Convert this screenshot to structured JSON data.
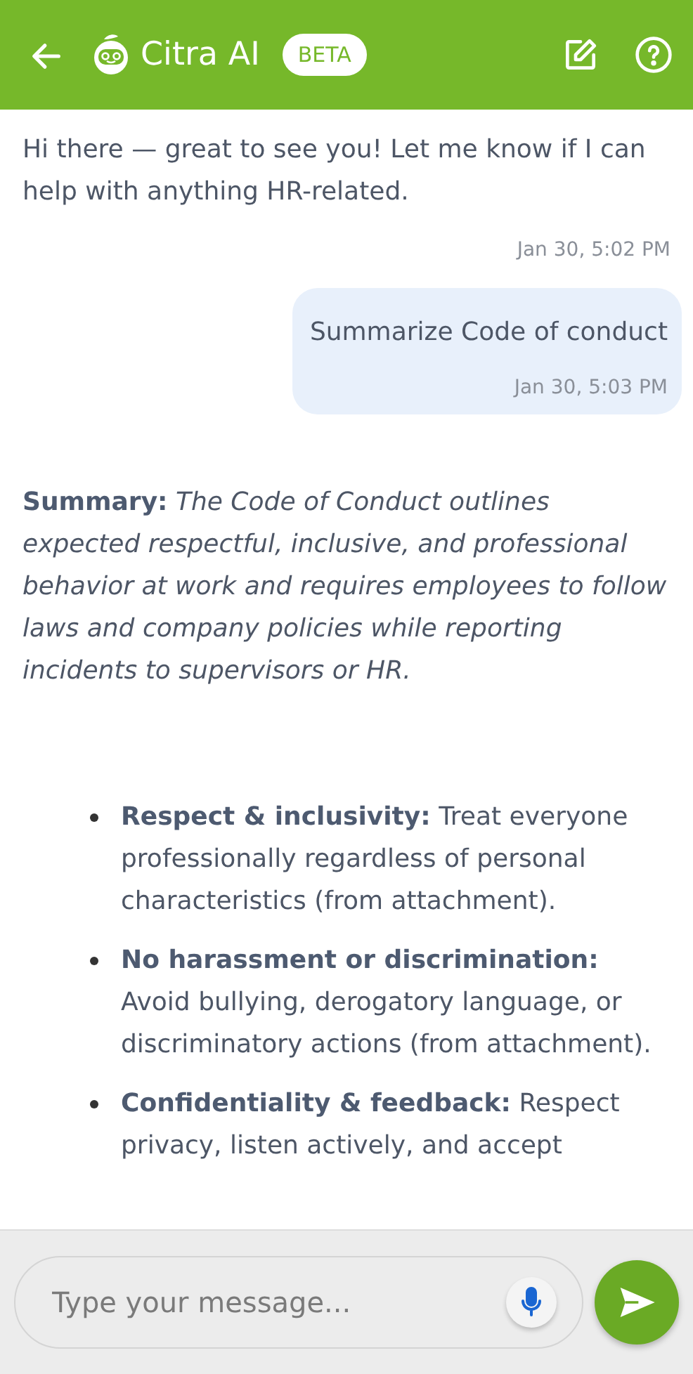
{
  "header": {
    "title": "Citra AI",
    "badge": "BETA"
  },
  "messages": [
    {
      "kind": "bot",
      "text": "Hi there — great to see you! Let me know if I can help with anything HR-related.",
      "time": "Jan 30, 5:02 PM"
    },
    {
      "kind": "user",
      "text": "Summarize Code of conduct",
      "time": "Jan 30, 5:03 PM"
    },
    {
      "kind": "bot",
      "text": "**Summary:** *The Code of Conduct outlines expected respectful, inclusive, and professional behavior at work and requires employees to follow laws and company policies while reporting incidents to supervisors or HR.*",
      "bullets": [
        "**Respect & inclusivity:** Treat everyone professionally regardless of personal characteristics (from attachment).",
        "**No harassment or discrimination:** Avoid bullying, derogatory language, or discriminatory actions (from attachment).",
        "**Confidentiality & feedback:** Respect privacy, listen actively, and accept"
      ]
    }
  ],
  "composer": {
    "placeholder": "Type your message..."
  }
}
